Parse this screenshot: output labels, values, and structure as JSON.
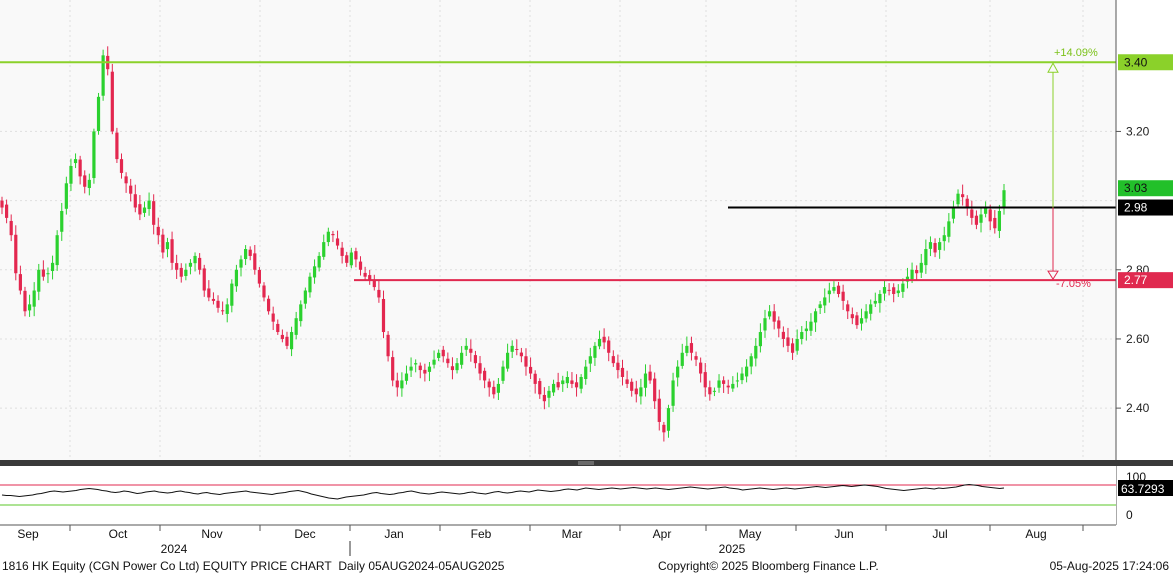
{
  "chart_data": {
    "type": "candlestick",
    "ticker_title": "1816 HK Equity (CGN Power Co Ltd) EQUITY PRICE CHART",
    "period_text": "Daily 05AUG2024-05AUG2025",
    "copyright": "Copyright© 2025 Bloomberg Finance L.P.",
    "timestamp": "05-Aug-2025 17:24:06",
    "months": [
      "Sep",
      "Oct",
      "Nov",
      "Dec",
      "Jan",
      "Feb",
      "Mar",
      "Apr",
      "May",
      "Jun",
      "Jul",
      "Aug"
    ],
    "years": [
      "2024",
      "2025"
    ],
    "y_ticks": [
      "2.40",
      "2.60",
      "2.80",
      "3.20"
    ],
    "ylim": [
      2.25,
      3.58
    ],
    "last_price_label": "3.03",
    "current_price": 3.03,
    "resistance": {
      "value": 3.4,
      "label": "3.40",
      "pct_label": "+14.09%"
    },
    "reference": {
      "value": 2.98,
      "label": "2.98"
    },
    "support": {
      "value": 2.77,
      "label": "2.77",
      "pct_label": "-7.05%"
    },
    "closes": [
      2.98,
      2.95,
      2.9,
      2.79,
      2.74,
      2.68,
      2.7,
      2.74,
      2.8,
      2.78,
      2.79,
      2.82,
      2.9,
      2.97,
      3.05,
      3.1,
      3.12,
      3.07,
      3.04,
      3.06,
      3.2,
      3.3,
      3.42,
      3.38,
      3.2,
      3.12,
      3.08,
      3.05,
      3.02,
      2.98,
      2.96,
      2.98,
      3.0,
      2.93,
      2.9,
      2.85,
      2.88,
      2.82,
      2.8,
      2.78,
      2.8,
      2.82,
      2.84,
      2.8,
      2.74,
      2.72,
      2.71,
      2.69,
      2.68,
      2.7,
      2.76,
      2.8,
      2.83,
      2.86,
      2.84,
      2.8,
      2.76,
      2.72,
      2.68,
      2.65,
      2.62,
      2.6,
      2.58,
      2.62,
      2.66,
      2.7,
      2.74,
      2.78,
      2.81,
      2.84,
      2.88,
      2.91,
      2.9,
      2.87,
      2.84,
      2.82,
      2.85,
      2.83,
      2.8,
      2.78,
      2.77,
      2.75,
      2.72,
      2.62,
      2.55,
      2.48,
      2.46,
      2.48,
      2.5,
      2.52,
      2.53,
      2.51,
      2.5,
      2.52,
      2.54,
      2.56,
      2.55,
      2.53,
      2.51,
      2.53,
      2.56,
      2.58,
      2.56,
      2.53,
      2.5,
      2.48,
      2.46,
      2.44,
      2.47,
      2.52,
      2.56,
      2.58,
      2.57,
      2.55,
      2.52,
      2.5,
      2.47,
      2.44,
      2.42,
      2.45,
      2.47,
      2.46,
      2.48,
      2.49,
      2.47,
      2.46,
      2.49,
      2.52,
      2.55,
      2.58,
      2.6,
      2.59,
      2.56,
      2.53,
      2.51,
      2.49,
      2.47,
      2.45,
      2.44,
      2.46,
      2.5,
      2.48,
      2.42,
      2.36,
      2.33,
      2.4,
      2.48,
      2.52,
      2.56,
      2.58,
      2.56,
      2.54,
      2.5,
      2.46,
      2.44,
      2.45,
      2.48,
      2.47,
      2.46,
      2.47,
      2.48,
      2.5,
      2.52,
      2.55,
      2.58,
      2.62,
      2.66,
      2.68,
      2.65,
      2.63,
      2.6,
      2.58,
      2.56,
      2.6,
      2.62,
      2.63,
      2.65,
      2.68,
      2.7,
      2.72,
      2.74,
      2.75,
      2.73,
      2.71,
      2.68,
      2.66,
      2.64,
      2.66,
      2.68,
      2.7,
      2.71,
      2.73,
      2.75,
      2.74,
      2.73,
      2.74,
      2.76,
      2.78,
      2.8,
      2.79,
      2.82,
      2.86,
      2.88,
      2.85,
      2.88,
      2.9,
      2.94,
      2.98,
      3.02,
      3.01,
      2.98,
      2.95,
      2.93,
      2.96,
      2.98,
      2.94,
      2.92,
      2.97,
      3.03
    ],
    "rsi": {
      "value_label": "63.7293",
      "top_label": "100",
      "bottom_label": "0",
      "upper": 70,
      "lower": 30,
      "values": [
        50,
        49,
        49,
        48,
        47,
        48,
        49,
        50,
        52,
        53,
        55,
        57,
        58,
        57,
        56,
        57,
        58,
        59,
        61,
        62,
        63,
        62,
        61,
        59,
        58,
        56,
        55,
        56,
        58,
        57,
        55,
        53,
        54,
        56,
        57,
        58,
        56,
        55,
        54,
        55,
        57,
        58,
        56,
        55,
        53,
        52,
        54,
        55,
        53,
        52,
        51,
        53,
        54,
        55,
        56,
        57,
        58,
        56,
        55,
        54,
        53,
        52,
        51,
        53,
        54,
        55,
        57,
        58,
        59,
        57,
        55,
        52,
        50,
        48,
        46,
        44,
        43,
        42,
        44,
        46,
        47,
        48,
        49,
        50,
        52,
        54,
        55,
        53,
        52,
        51,
        52,
        54,
        55,
        57,
        58,
        56,
        54,
        53,
        52,
        53,
        55,
        56,
        55,
        54,
        53,
        52,
        53,
        55,
        56,
        54,
        53,
        52,
        54,
        56,
        57,
        55,
        54,
        55,
        57,
        58,
        57,
        56,
        58,
        60,
        59,
        58,
        57,
        58,
        59,
        61,
        62,
        61,
        60,
        62,
        64,
        63,
        62,
        61,
        62,
        63,
        64,
        63,
        62,
        63,
        64,
        65,
        64,
        63,
        62,
        63,
        64,
        63,
        62,
        61,
        62,
        63,
        64,
        65,
        66,
        65,
        64,
        63,
        62,
        63,
        64,
        65,
        66,
        64,
        63,
        62,
        60,
        61,
        62,
        63,
        64,
        63,
        62,
        61,
        62,
        63,
        64,
        63,
        62,
        63,
        64,
        65,
        66,
        67,
        66,
        65,
        66,
        67,
        68,
        69,
        68,
        67,
        68,
        69,
        70,
        69,
        68,
        67,
        65,
        63,
        62,
        61,
        60,
        59,
        60,
        61,
        62,
        63,
        64,
        63,
        62,
        64,
        63,
        64,
        65,
        66,
        68,
        70,
        71,
        70,
        69,
        67,
        66,
        65,
        64,
        63,
        64
      ]
    }
  }
}
